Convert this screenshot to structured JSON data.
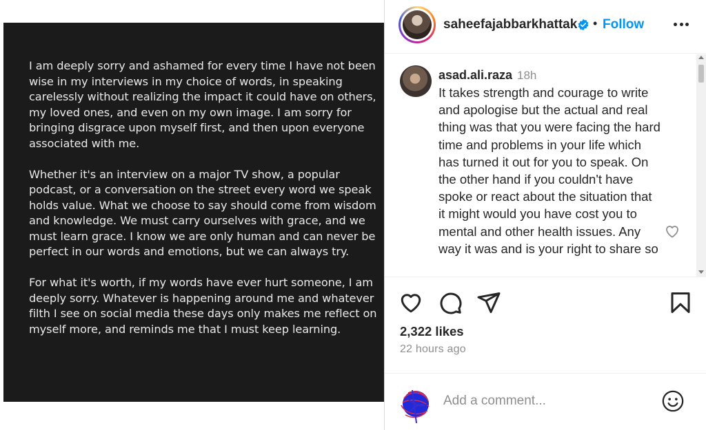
{
  "post": {
    "paragraphs": [
      "I am deeply sorry and ashamed for every time I have not been wise in my interviews in my choice of words, in speaking carelessly without realizing the impact it could have on others, my loved ones, and even on my own image. I am sorry for bringing disgrace upon myself first, and then upon everyone associated with me.",
      "Whether it's an interview on a major TV show, a popular podcast, or a conversation on the street every word we speak holds value. What we choose to say should come from wisdom and knowledge. We must carry ourselves with grace, and we must learn grace. I know we are only human and can never be perfect in our words and emotions, but we can always try.",
      "For what it's worth, if my words have ever hurt someone, I am deeply sorry. Whatever is happening around me and whatever filth I see on social media these days only makes me reflect on myself more, and reminds me that I must keep learning."
    ]
  },
  "header": {
    "username": "saheefajabbarkhattak",
    "separator": "•",
    "follow_label": "Follow"
  },
  "comment": {
    "username": "asad.ali.raza",
    "time": "18h",
    "text": "It takes strength and courage to write and apologise but the actual and real thing was that you were facing the hard time and problems in your life which has turned it out for you to speak. On the other hand if you couldn't have spoke or react about the situation that it might would you have cost you to mental and other health issues. Any way it was and is your right to share so"
  },
  "stats": {
    "likes": "2,322 likes",
    "time_ago": "22 hours ago"
  },
  "composer": {
    "placeholder": "Add a comment..."
  },
  "icons": {
    "verified": "verified-badge-icon",
    "more": "more-options-icon",
    "like": "heart-icon",
    "comment": "comment-icon",
    "share": "send-icon",
    "save": "bookmark-icon",
    "emoji": "emoji-icon"
  },
  "colors": {
    "accent": "#0095f6",
    "post_background": "#1b1b1b",
    "post_text": "#e9e9e9",
    "muted": "#8e8e8e"
  }
}
